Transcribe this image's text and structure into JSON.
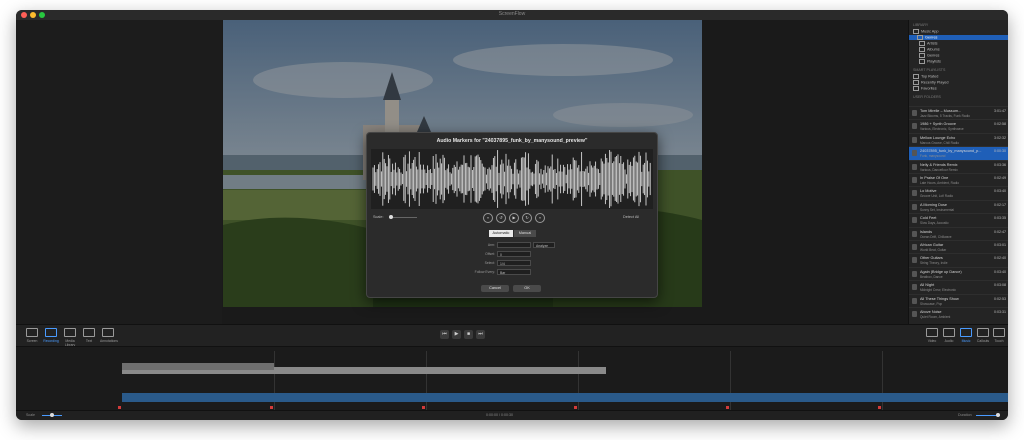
{
  "window": {
    "title": "ScreenFlow"
  },
  "sidebar": {
    "section_library": "Library",
    "library_items": [
      "Music App",
      "Genres",
      "Artists",
      "Albums",
      "Genres",
      "Playlists"
    ],
    "section_smart": "Smart Playlists",
    "smart_items": [
      "Top Rated",
      "Recently Played",
      "Favorites"
    ],
    "section_user": "User Folders",
    "tracks": [
      {
        "title": "Tom Mirelle – Mussum...",
        "sub": "Jazz Blooms, 5 Tracks, Funk Radio",
        "dur": "3:01:47"
      },
      {
        "title": "1986 + Synth Groove",
        "sub": "Various, Electronic, Synthwave",
        "dur": "0:02:58"
      },
      {
        "title": "Mellow Lounge Echo",
        "sub": "Marcus Groove, Chill Radio",
        "dur": "3:02:32"
      },
      {
        "title": "24037895_funk_by_manysound_p...",
        "sub": "Funk, manysound",
        "dur": "0:00:30"
      },
      {
        "title": "Nelly & Friends Remix",
        "sub": "Various, Dancefloor Remix",
        "dur": "0:03:36"
      },
      {
        "title": "In Praise Of One",
        "sub": "Late Hours, Ambient, Radio",
        "dur": "0:02:49"
      },
      {
        "title": "Lo Motive",
        "sub": "Groove Unit, Lofi Radio",
        "dur": "0:03:40"
      },
      {
        "title": "A Morning Dose",
        "sub": "Sunny Set, Instrumental",
        "dur": "0:02:17"
      },
      {
        "title": "Cold Feet",
        "sub": "Slow Days, Acoustic",
        "dur": "0:03:35"
      },
      {
        "title": "Islands",
        "sub": "Ocean Drift, Chillwave",
        "dur": "0:02:47"
      },
      {
        "title": "African Guitar",
        "sub": "World Beat, Guitar",
        "dur": "0:03:01"
      },
      {
        "title": "Other Guitars",
        "sub": "String Theory, Indie",
        "dur": "0:02:40"
      },
      {
        "title": "Again (Bridge up Dance)",
        "sub": "Beatbox, Dance",
        "dur": "0:03:40"
      },
      {
        "title": "All Night",
        "sub": "Midnight Crew, Electronic",
        "dur": "0:03:08"
      },
      {
        "title": "All These Things Show",
        "sub": "Showcase, Pop",
        "dur": "0:02:53"
      },
      {
        "title": "Above Noise",
        "sub": "Quiet Room, Ambient",
        "dur": "0:03:31"
      }
    ],
    "selected_track_index": 3
  },
  "dialog": {
    "title": "Audio Markers for \"24037895_funk_by_manysound_preview\"",
    "scale_label": "Scale:",
    "detect_label": "Detect All",
    "tabs": [
      "Automatic",
      "Manual"
    ],
    "active_tab": "Automatic",
    "fields": [
      {
        "label": "Arm:",
        "value": "",
        "extra": "Analyze"
      },
      {
        "label": "Offset:",
        "value": "0"
      },
      {
        "label": "Select:",
        "value": "1/4"
      },
      {
        "label": "Follow Every:",
        "value": "Bar"
      }
    ],
    "cancel_label": "Cancel",
    "ok_label": "OK"
  },
  "toolbar": {
    "left_buttons": [
      "Screen",
      "Recording",
      "Media Library",
      "Text",
      "Annotations"
    ],
    "right_buttons": [
      "Video",
      "Audio",
      "Music",
      "Callouts",
      "Touch"
    ],
    "active_left": 1,
    "active_right": 2
  },
  "status": {
    "left": "Scale",
    "center": "0:00:00 / 0:00:30",
    "right": "Duration"
  },
  "colors": {
    "accent": "#1f5fb8",
    "audio_clip": "#2a5a8a",
    "marker": "#d23b3b"
  }
}
